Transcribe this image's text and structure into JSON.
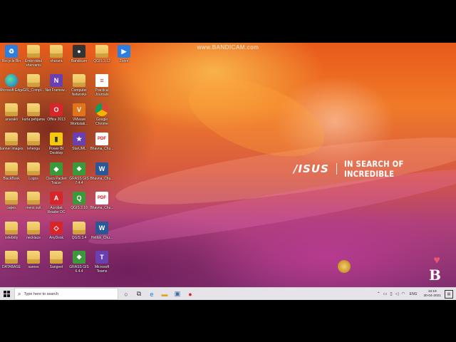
{
  "watermark": "www.BANDICAM.com",
  "brand": {
    "logo": "/ISUS",
    "tagline": "IN SEARCH OF INCREDIBLE"
  },
  "desktop_icons": [
    {
      "label": "Recycle Bin",
      "icon": "recycle-bin-icon",
      "kind": "blue",
      "glyph": "♻"
    },
    {
      "label": "Embroided shervanis",
      "icon": "folder-icon",
      "kind": "folder",
      "glyph": ""
    },
    {
      "label": "sharara",
      "icon": "folder-icon",
      "kind": "folder",
      "glyph": ""
    },
    {
      "label": "Bandicam",
      "icon": "bandicam-icon",
      "kind": "dark",
      "glyph": "●"
    },
    {
      "label": "QGIS 3.12",
      "icon": "folder-icon",
      "kind": "folder",
      "glyph": ""
    },
    {
      "label": "Zoom",
      "icon": "zoom-icon",
      "kind": "blue",
      "glyph": "▶"
    },
    {
      "label": "Microsoft Edge",
      "icon": "edge-icon",
      "kind": "edge",
      "glyph": ""
    },
    {
      "label": "GIS_Compl...",
      "icon": "folder-icon",
      "kind": "folder",
      "glyph": ""
    },
    {
      "label": "Net Framew...",
      "icon": "net-framework-icon",
      "kind": "purple",
      "glyph": "N"
    },
    {
      "label": "Computer Networks",
      "icon": "folder-icon",
      "kind": "folder",
      "glyph": ""
    },
    {
      "label": "Practical Journals",
      "icon": "document-icon",
      "kind": "doc",
      "glyph": "≡"
    },
    {
      "label": "anarakli",
      "icon": "folder-icon",
      "kind": "folder",
      "glyph": ""
    },
    {
      "label": "kurta pehjama",
      "icon": "folder-icon",
      "kind": "folder",
      "glyph": ""
    },
    {
      "label": "Office 2013",
      "icon": "office-icon",
      "kind": "red",
      "glyph": "O"
    },
    {
      "label": "VMware Workstati...",
      "icon": "vmware-icon",
      "kind": "orange",
      "glyph": "V"
    },
    {
      "label": "Google Chrome",
      "icon": "chrome-icon",
      "kind": "chrome",
      "glyph": ""
    },
    {
      "label": "banner images",
      "icon": "folder-icon",
      "kind": "folder",
      "glyph": ""
    },
    {
      "label": "lehenga",
      "icon": "folder-icon",
      "kind": "folder",
      "glyph": ""
    },
    {
      "label": "Power BI Desktop",
      "icon": "power-bi-icon",
      "kind": "yellow",
      "glyph": "▮"
    },
    {
      "label": "StarUML",
      "icon": "staruml-icon",
      "kind": "purple",
      "glyph": "★"
    },
    {
      "label": "Bhavna_Chu...",
      "icon": "pdf-icon",
      "kind": "pdf",
      "glyph": "PDF"
    },
    {
      "label": "BlackBook",
      "icon": "folder-icon",
      "kind": "folder",
      "glyph": ""
    },
    {
      "label": "Logos",
      "icon": "folder-icon",
      "kind": "folder",
      "glyph": ""
    },
    {
      "label": "Cisco Packet Tracer",
      "icon": "cisco-icon",
      "kind": "green",
      "glyph": "◆"
    },
    {
      "label": "GRASS GIS 7.4.4",
      "icon": "grass-gis-icon",
      "kind": "green",
      "glyph": "❖"
    },
    {
      "label": "Bhavna_Chu...",
      "icon": "word-icon",
      "kind": "word",
      "glyph": "W"
    },
    {
      "label": "capes",
      "icon": "folder-icon",
      "kind": "folder",
      "glyph": ""
    },
    {
      "label": "mens suit",
      "icon": "folder-icon",
      "kind": "folder",
      "glyph": ""
    },
    {
      "label": "Acrobat Reader DC",
      "icon": "acrobat-icon",
      "kind": "red",
      "glyph": "A"
    },
    {
      "label": "QGIS 2.18",
      "icon": "qgis-icon",
      "kind": "green",
      "glyph": "Q"
    },
    {
      "label": "Bhavna_Chu...",
      "icon": "pdf-icon",
      "kind": "pdf",
      "glyph": "PDF"
    },
    {
      "label": "celebrity",
      "icon": "folder-icon",
      "kind": "folder",
      "glyph": ""
    },
    {
      "label": "necklace",
      "icon": "folder-icon",
      "kind": "folder",
      "glyph": ""
    },
    {
      "label": "AnyDesk",
      "icon": "anydesk-icon",
      "kind": "red",
      "glyph": "◇"
    },
    {
      "label": "QGIS 3.4",
      "icon": "folder-icon",
      "kind": "folder",
      "glyph": ""
    },
    {
      "label": "Hrithik_Chu...",
      "icon": "word-icon",
      "kind": "word",
      "glyph": "W"
    },
    {
      "label": "DATABASE",
      "icon": "folder-icon",
      "kind": "folder",
      "glyph": ""
    },
    {
      "label": "sarees",
      "icon": "folder-icon",
      "kind": "folder",
      "glyph": ""
    },
    {
      "label": "Sangeet",
      "icon": "folder-icon",
      "kind": "folder",
      "glyph": ""
    },
    {
      "label": "GRASS GIS 6.4.4",
      "icon": "grass-gis-icon",
      "kind": "green",
      "glyph": "❖"
    },
    {
      "label": "Microsoft Teams",
      "icon": "teams-icon",
      "kind": "purple",
      "glyph": "T"
    }
  ],
  "taskbar": {
    "search_placeholder": "Type here to search",
    "pinned": [
      {
        "icon": "task-view-icon",
        "glyph": "○"
      },
      {
        "icon": "multitask-icon",
        "glyph": "⧉"
      },
      {
        "icon": "edge-taskbar-icon",
        "glyph": "e"
      },
      {
        "icon": "file-explorer-icon",
        "glyph": "▬"
      },
      {
        "icon": "window-app-icon",
        "glyph": "▣"
      },
      {
        "icon": "bandicam-taskbar-icon",
        "glyph": "●"
      }
    ],
    "tray": {
      "language": "ENG",
      "time": "15:19",
      "date": "30-04-2021"
    }
  },
  "colors": {
    "taskbar_bg": "#e6e4e9",
    "folder": "#f2c24a",
    "pinned_edge": "#1a7fd6",
    "record_red": "#d8232a"
  }
}
